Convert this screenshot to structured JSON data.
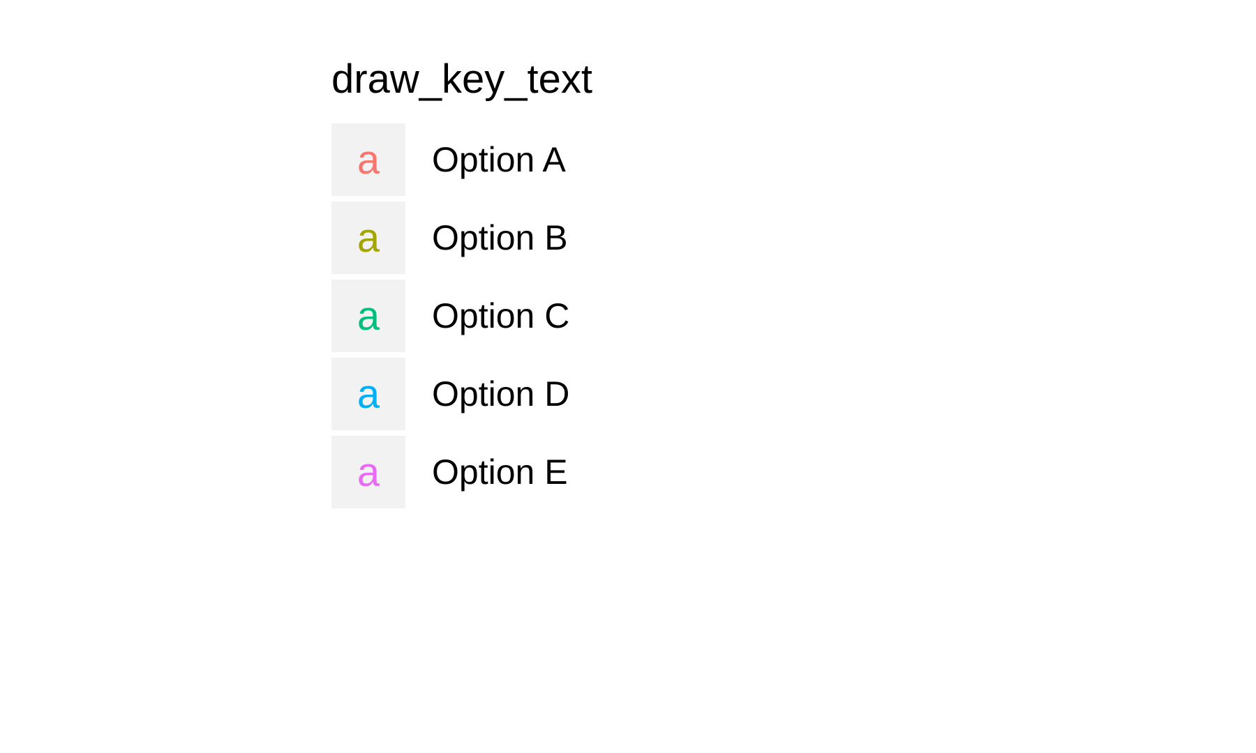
{
  "chart_data": {
    "type": "legend",
    "title": "draw_key_text",
    "glyph": "a",
    "items": [
      {
        "label": "Option A",
        "color": "#F8766D"
      },
      {
        "label": "Option B",
        "color": "#A3A500"
      },
      {
        "label": "Option C",
        "color": "#00BF7D"
      },
      {
        "label": "Option D",
        "color": "#00B0F6"
      },
      {
        "label": "Option E",
        "color": "#E76BF3"
      }
    ]
  }
}
